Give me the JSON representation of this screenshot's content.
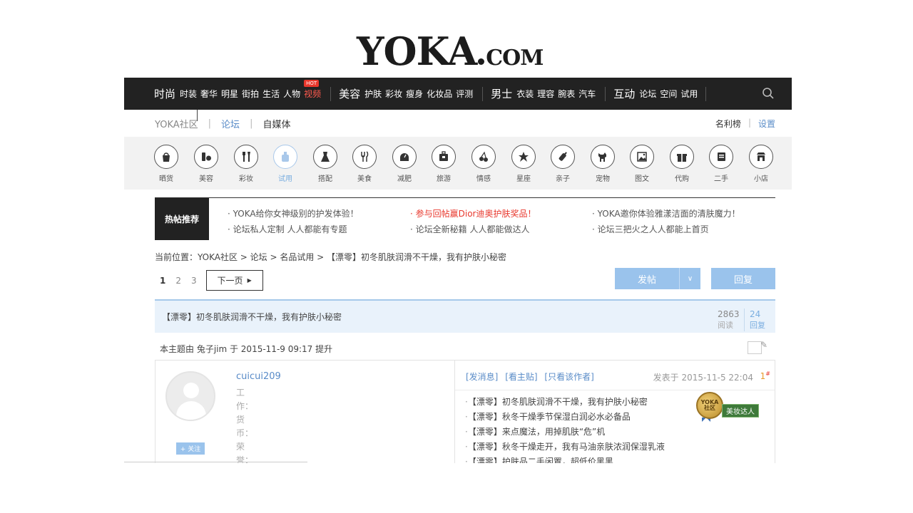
{
  "logo": {
    "main": "YOKA",
    "suffix": "COM"
  },
  "topnav": {
    "groups": [
      {
        "main": "时尚",
        "subs": [
          "时装",
          "奢华",
          "明星",
          "街拍",
          "生活",
          "人物"
        ],
        "hot": "视频",
        "hot_badge": "HOT"
      },
      {
        "main": "美容",
        "subs": [
          "护肤",
          "彩妆",
          "瘦身",
          "化妆品",
          "评测"
        ]
      },
      {
        "main": "男士",
        "subs": [
          "衣装",
          "理容",
          "腕表",
          "汽车"
        ]
      },
      {
        "main": "互动",
        "subs": [
          "论坛",
          "空间",
          "试用"
        ]
      }
    ]
  },
  "subnav": {
    "items": [
      "YOKA社区",
      "论坛",
      "自媒体"
    ],
    "right": [
      "名利榜",
      "设置"
    ]
  },
  "categories": [
    {
      "label": "晒货",
      "icon": "bag-icon"
    },
    {
      "label": "美容",
      "icon": "cosmetics-icon"
    },
    {
      "label": "彩妆",
      "icon": "makeup-brush-icon"
    },
    {
      "label": "试用",
      "icon": "trial-bottle-icon"
    },
    {
      "label": "搭配",
      "icon": "dress-icon"
    },
    {
      "label": "美食",
      "icon": "fork-icon"
    },
    {
      "label": "减肥",
      "icon": "scale-icon"
    },
    {
      "label": "旅游",
      "icon": "suitcase-icon"
    },
    {
      "label": "情感",
      "icon": "cherry-icon"
    },
    {
      "label": "星座",
      "icon": "star-icon"
    },
    {
      "label": "亲子",
      "icon": "baby-bottle-icon"
    },
    {
      "label": "宠物",
      "icon": "dog-icon"
    },
    {
      "label": "图文",
      "icon": "picture-icon"
    },
    {
      "label": "代购",
      "icon": "gift-icon"
    },
    {
      "label": "二手",
      "icon": "card-icon"
    },
    {
      "label": "小店",
      "icon": "shop-icon"
    }
  ],
  "hot_posts": {
    "label": "热帖推荐",
    "items": [
      "· YOKA给你女神级别的护发体验！",
      "· 参与回帖赢Dior迪奥护肤奖品！",
      "· YOKA邀你体验雅漾洁面的清肤魔力！",
      "· 论坛私人定制 人人都能有专题",
      "· 论坛全新秘籍 人人都能做达人",
      "· 论坛三把火之人人都能上首页"
    ]
  },
  "breadcrumb": "当前位置：YOKA社区 > 论坛 > 名品试用 > 【漂零】初冬肌肤润滑不干燥，我有护肤小秘密",
  "pager": {
    "pages": [
      "1",
      "2",
      "3"
    ],
    "next": "下一页"
  },
  "buttons": {
    "post": "发帖",
    "reply": "回复"
  },
  "thread": {
    "title": "【漂零】初冬肌肤润滑不干燥，我有护肤小秘密",
    "views": "2863",
    "views_label": "阅读",
    "replies": "24",
    "replies_label": "回复",
    "bump": "本主题由 兔子jim 于 2015-11-9 09:17 提升"
  },
  "post": {
    "username": "cuicui209",
    "fields": "工作：货币：荣誉：",
    "follow": "+ 关注",
    "actions": [
      "[发消息]",
      "[看主贴]",
      "[只看该作者]"
    ],
    "time": "发表于 2015-11-5 22:04",
    "floor": "1",
    "floor_mark": "#",
    "links": [
      "【漂零】初冬肌肤润滑不干燥，我有护肤小秘密",
      "【漂零】秋冬干燥季节保湿白润必水必备品",
      "【漂零】来点魔法，用掉肌肤“危”机",
      "【漂零】秋冬干燥走开，我有马油亲肤浓润保湿乳液",
      "【漂零】护肤品二手闲置，超低价黑黑"
    ],
    "badge_text": "美妆达人",
    "medal_text": "YOKA 社区"
  }
}
